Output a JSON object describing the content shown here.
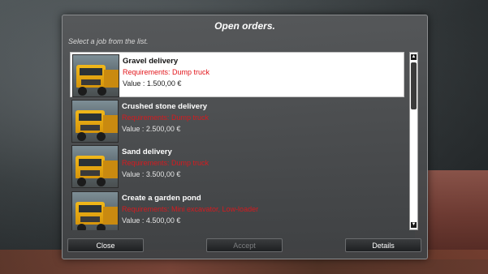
{
  "dialog": {
    "title": "Open orders.",
    "subtitle": "Select a job from the list."
  },
  "jobs": [
    {
      "name": "Gravel delivery",
      "requirements": "Requirements: Dump truck",
      "value": "Value : 1.500,00 €",
      "selected": true,
      "icon": "dump-truck-icon"
    },
    {
      "name": "Crushed stone delivery",
      "requirements": "Requirements: Dump truck",
      "value": "Value : 2.500,00 €",
      "selected": false,
      "icon": "dump-truck-icon"
    },
    {
      "name": "Sand delivery",
      "requirements": "Requirements: Dump truck",
      "value": "Value : 3.500,00 €",
      "selected": false,
      "icon": "dump-truck-icon"
    },
    {
      "name": "Create a garden pond",
      "requirements": "Requirements: Mini excavator, Low-loader",
      "value": "Value : 4.500,00 €",
      "selected": false,
      "icon": "dump-truck-icon"
    }
  ],
  "buttons": {
    "close": "Close",
    "accept": "Accept",
    "details": "Details"
  },
  "colors": {
    "requirement_text": "#e2151b",
    "selected_row": "#ffffff"
  }
}
